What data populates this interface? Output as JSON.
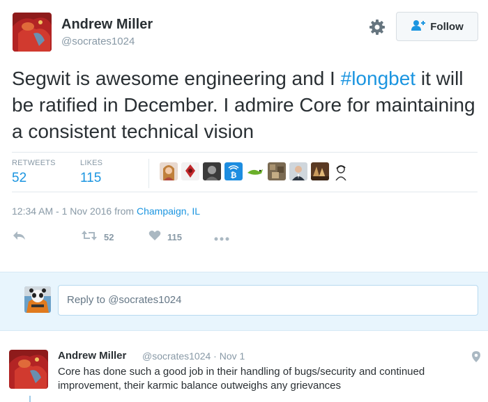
{
  "tweet": {
    "author_name": "Andrew Miller",
    "author_handle": "@socrates1024",
    "follow_label": "Follow",
    "text_before": "Segwit is awesome engineering and I ",
    "hashtag": "#longbet",
    "text_after": " it will be ratified in December. I admire Core for maintaining a consistent technical vision",
    "retweets_label": "RETWEETS",
    "retweets_count": "52",
    "likes_label": "LIKES",
    "likes_count": "115",
    "time": "12:34 AM - 1 Nov 2016 from ",
    "location": "Champaign, IL",
    "action_retweet_count": "52",
    "action_like_count": "115"
  },
  "reply_box": {
    "placeholder": "Reply to @socrates1024"
  },
  "reply_tweet": {
    "author_name": "Andrew Miller",
    "meta": "@socrates1024 · Nov 1",
    "text": "Core has done such a good job in their handling of bugs/security and continued improvement, their karmic balance outweighs any grievances"
  },
  "colors": {
    "link_blue": "#1b95e0",
    "muted_gray": "#8899a6",
    "reply_bg": "#e8f5fd",
    "text_dark": "#292f33"
  },
  "icons": {
    "settings": "gear-icon",
    "follow": "follow-person-plus-icon",
    "reply": "reply-arrow-icon",
    "retweet": "retweet-icon",
    "like": "heart-icon",
    "more": "more-dots-icon",
    "location": "map-pin-icon"
  }
}
